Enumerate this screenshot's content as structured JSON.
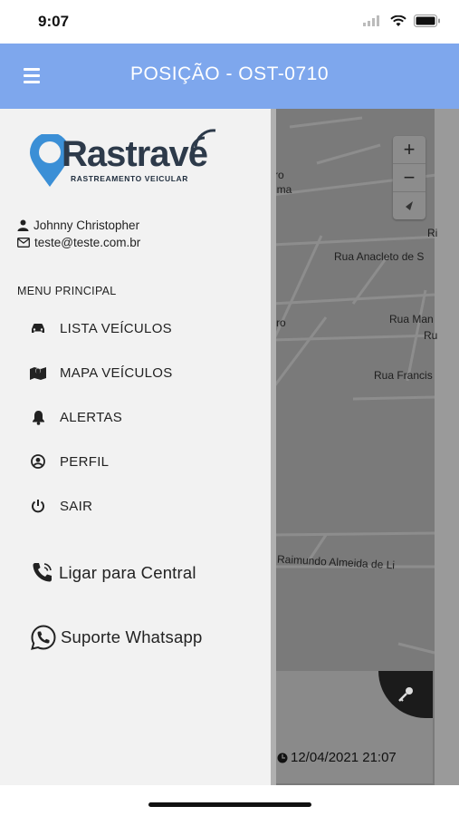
{
  "status_bar": {
    "time": "9:07"
  },
  "header": {
    "title": "POSIÇÃO - OST-0710"
  },
  "drawer": {
    "logo": {
      "brand": "Rastrave",
      "tagline": "RASTREAMENTO VEICULAR"
    },
    "user": {
      "name": "Johnny Christopher",
      "email": "teste@teste.com.br"
    },
    "menu_heading": "MENU PRINCIPAL",
    "menu_items": [
      {
        "label": "LISTA VEÍCULOS",
        "icon": "car-icon"
      },
      {
        "label": "MAPA VEÍCULOS",
        "icon": "map-marker-icon"
      },
      {
        "label": "ALERTAS",
        "icon": "bell-icon"
      },
      {
        "label": "PERFIL",
        "icon": "user-circle-icon"
      },
      {
        "label": "SAIR",
        "icon": "power-icon"
      }
    ],
    "contact": {
      "call_label": "Ligar para Central",
      "whatsapp_label": "Suporte Whatsapp"
    }
  },
  "map": {
    "zoom_in": "+",
    "zoom_out": "−",
    "streets": [
      "ro",
      "ima",
      "Ri",
      "Rua Anacleto de S",
      "ro",
      "Rua Man",
      "Ru",
      "Rua Francis",
      "Raimundo Almeida de Li"
    ],
    "last_update": "12/04/2021 21:07"
  }
}
